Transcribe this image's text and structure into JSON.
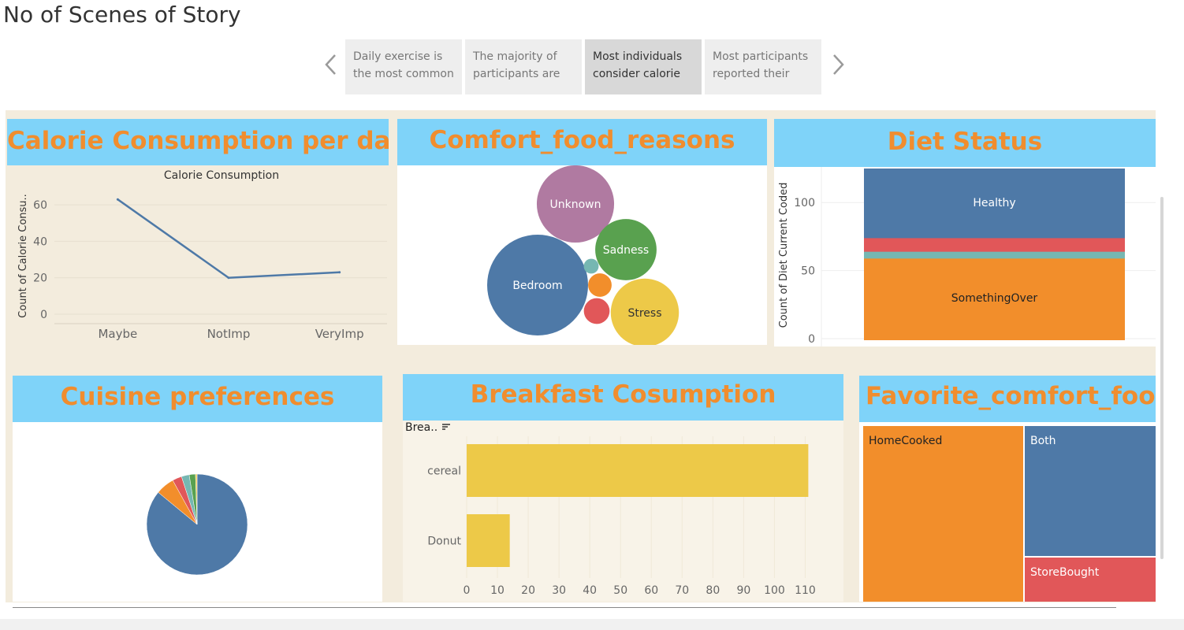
{
  "story": {
    "title": "No of Scenes of Story",
    "prev_icon": "chevron-left-icon",
    "next_icon": "chevron-right-icon",
    "points": [
      {
        "line1": "Daily exercise is",
        "line2": "the most common"
      },
      {
        "line1": "The majority of",
        "line2": "participants are"
      },
      {
        "line1": "Most individuals",
        "line2": "consider calorie"
      },
      {
        "line1": "Most participants",
        "line2": "reported their"
      }
    ],
    "active_index": 2
  },
  "panels": {
    "calorie": {
      "header": "Calorie Consumption per day"
    },
    "comfort_reasons": {
      "header": "Comfort_food_reasons"
    },
    "diet": {
      "header": "Diet Status"
    },
    "cuisine": {
      "header": "Cuisine preferences"
    },
    "breakfast": {
      "header": "Breakfast Cosumption",
      "field_label": "Brea..",
      "sort_icon": "sort-descending-icon"
    },
    "favorite": {
      "header": "Favorite_comfort_foods"
    }
  },
  "colors": {
    "header_bg": "#7fd3f9",
    "header_text": "#f08d2e",
    "canvas_bg": "#f3ecdd",
    "blue": "#4e79a7",
    "orange": "#f28e2b",
    "red": "#e15759",
    "teal": "#76b7b2",
    "green": "#59a14f",
    "yellow": "#edc948",
    "purple": "#b07aa1"
  },
  "chart_data": [
    {
      "id": "calorie",
      "type": "line",
      "title": "Calorie Consumption",
      "ylabel": "Count of Calorie Consu..",
      "categories": [
        "Maybe",
        "NotImp",
        "VeryImp"
      ],
      "values": [
        63,
        20,
        23
      ],
      "ylim": [
        0,
        70
      ],
      "yticks": [
        0,
        20,
        40,
        60
      ],
      "grid": true
    },
    {
      "id": "comfort_reasons",
      "type": "bubble",
      "items": [
        {
          "label": "Bedroom",
          "value": 46,
          "color": "#4e79a7"
        },
        {
          "label": "Unknown",
          "value": 27,
          "color": "#b07aa1"
        },
        {
          "label": "Stress",
          "value": 21,
          "color": "#edc948"
        },
        {
          "label": "Sadness",
          "value": 17,
          "color": "#59a14f"
        },
        {
          "label": "",
          "value": 3,
          "color": "#e15759"
        },
        {
          "label": "",
          "value": 2.5,
          "color": "#f28e2b"
        },
        {
          "label": "",
          "value": 1,
          "color": "#76b7b2"
        }
      ]
    },
    {
      "id": "diet",
      "type": "bar",
      "stacked": true,
      "ylabel": "Count of Diet Current Coded",
      "ylim": [
        0,
        125
      ],
      "yticks": [
        0,
        50,
        100
      ],
      "series": [
        {
          "name": "SomethingOver",
          "value": 60,
          "color": "#f28e2b"
        },
        {
          "name": "",
          "value": 5,
          "color": "#76b7b2"
        },
        {
          "name": "",
          "value": 10,
          "color": "#e15759"
        },
        {
          "name": "Healthy",
          "value": 50,
          "color": "#4e79a7"
        }
      ]
    },
    {
      "id": "cuisine",
      "type": "pie",
      "slices": [
        {
          "value": 86,
          "color": "#4e79a7"
        },
        {
          "value": 6,
          "color": "#f28e2b"
        },
        {
          "value": 3,
          "color": "#e15759"
        },
        {
          "value": 2.5,
          "color": "#76b7b2"
        },
        {
          "value": 2,
          "color": "#59a14f"
        },
        {
          "value": 0.5,
          "color": "#edc948"
        }
      ]
    },
    {
      "id": "breakfast",
      "type": "bar",
      "orientation": "horizontal",
      "categories": [
        "cereal",
        "Donut"
      ],
      "values": [
        111,
        14
      ],
      "xlim": [
        0,
        115
      ],
      "xticks": [
        0,
        10,
        20,
        30,
        40,
        50,
        60,
        70,
        80,
        90,
        100,
        110
      ],
      "color": "#edc948"
    },
    {
      "id": "favorite",
      "type": "treemap",
      "items": [
        {
          "label": "HomeCooked",
          "value": 60,
          "color": "#f28e2b"
        },
        {
          "label": "Both",
          "value": 32,
          "color": "#4e79a7"
        },
        {
          "label": "StoreBought",
          "value": 11,
          "color": "#e15759"
        }
      ]
    }
  ]
}
